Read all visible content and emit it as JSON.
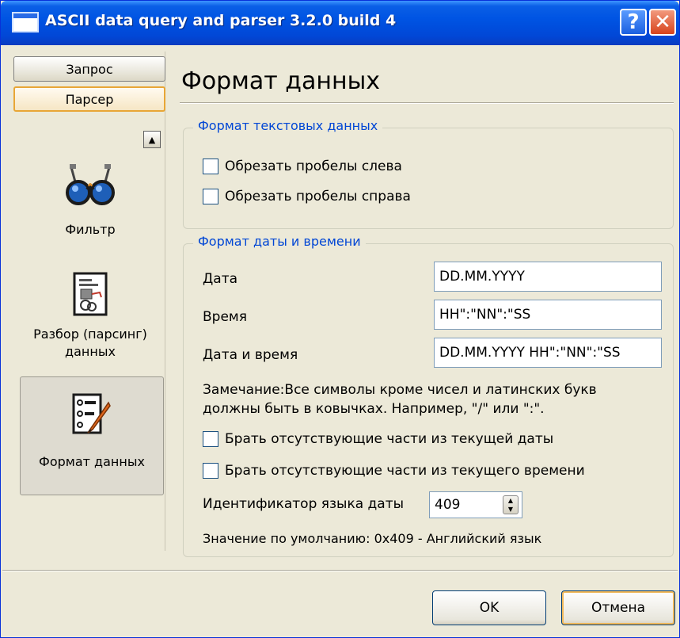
{
  "window": {
    "title": "ASCII data query and parser 3.2.0 build 4",
    "help_label": "?",
    "close_label": "✕",
    "titlebar_color": "#0054e3",
    "close_color": "#d7431c"
  },
  "nav": {
    "tabs": [
      {
        "label": "Запрос",
        "selected": false
      },
      {
        "label": "Парсер",
        "selected": true
      }
    ],
    "scroll_up_label": "▲",
    "items": [
      {
        "label": "Фильтр",
        "icon": "glasses-icon"
      },
      {
        "label": "Разбор (парсинг) данных",
        "icon": "parse-document-icon"
      },
      {
        "label": "Формат данных",
        "icon": "format-list-pen-icon",
        "selected": true
      }
    ]
  },
  "main": {
    "title": "Формат данных",
    "text_format": {
      "legend": "Формат текстовых данных",
      "trim_left_label": "Обрезать пробелы слева",
      "trim_left_checked": false,
      "trim_right_label": "Обрезать пробелы справа",
      "trim_right_checked": false
    },
    "datetime_format": {
      "legend": "Формат даты и времени",
      "date_label": "Дата",
      "date_value": "DD.MM.YYYY",
      "time_label": "Время",
      "time_value": "HH\":\"NN\":\"SS",
      "datetime_label": "Дата и время",
      "datetime_value": "DD.MM.YYYY HH\":\"NN\":\"SS",
      "note_line1": "Замечание:Все символы кроме чисел и латинских букв",
      "note_line2": "должны быть в ковычках. Например, \"/\" или \":\".",
      "missing_date_label": "Брать отсутствующие части из текущей даты",
      "missing_date_checked": false,
      "missing_time_label": "Брать отсутствующие части из текущего времени",
      "missing_time_checked": false,
      "lang_id_label": "Идентификатор языка даты",
      "lang_id_value": "409",
      "default_note": "Значение по умолчанию: 0x409 - Английский язык"
    }
  },
  "footer": {
    "ok_label": "OK",
    "cancel_label": "Отмена"
  }
}
